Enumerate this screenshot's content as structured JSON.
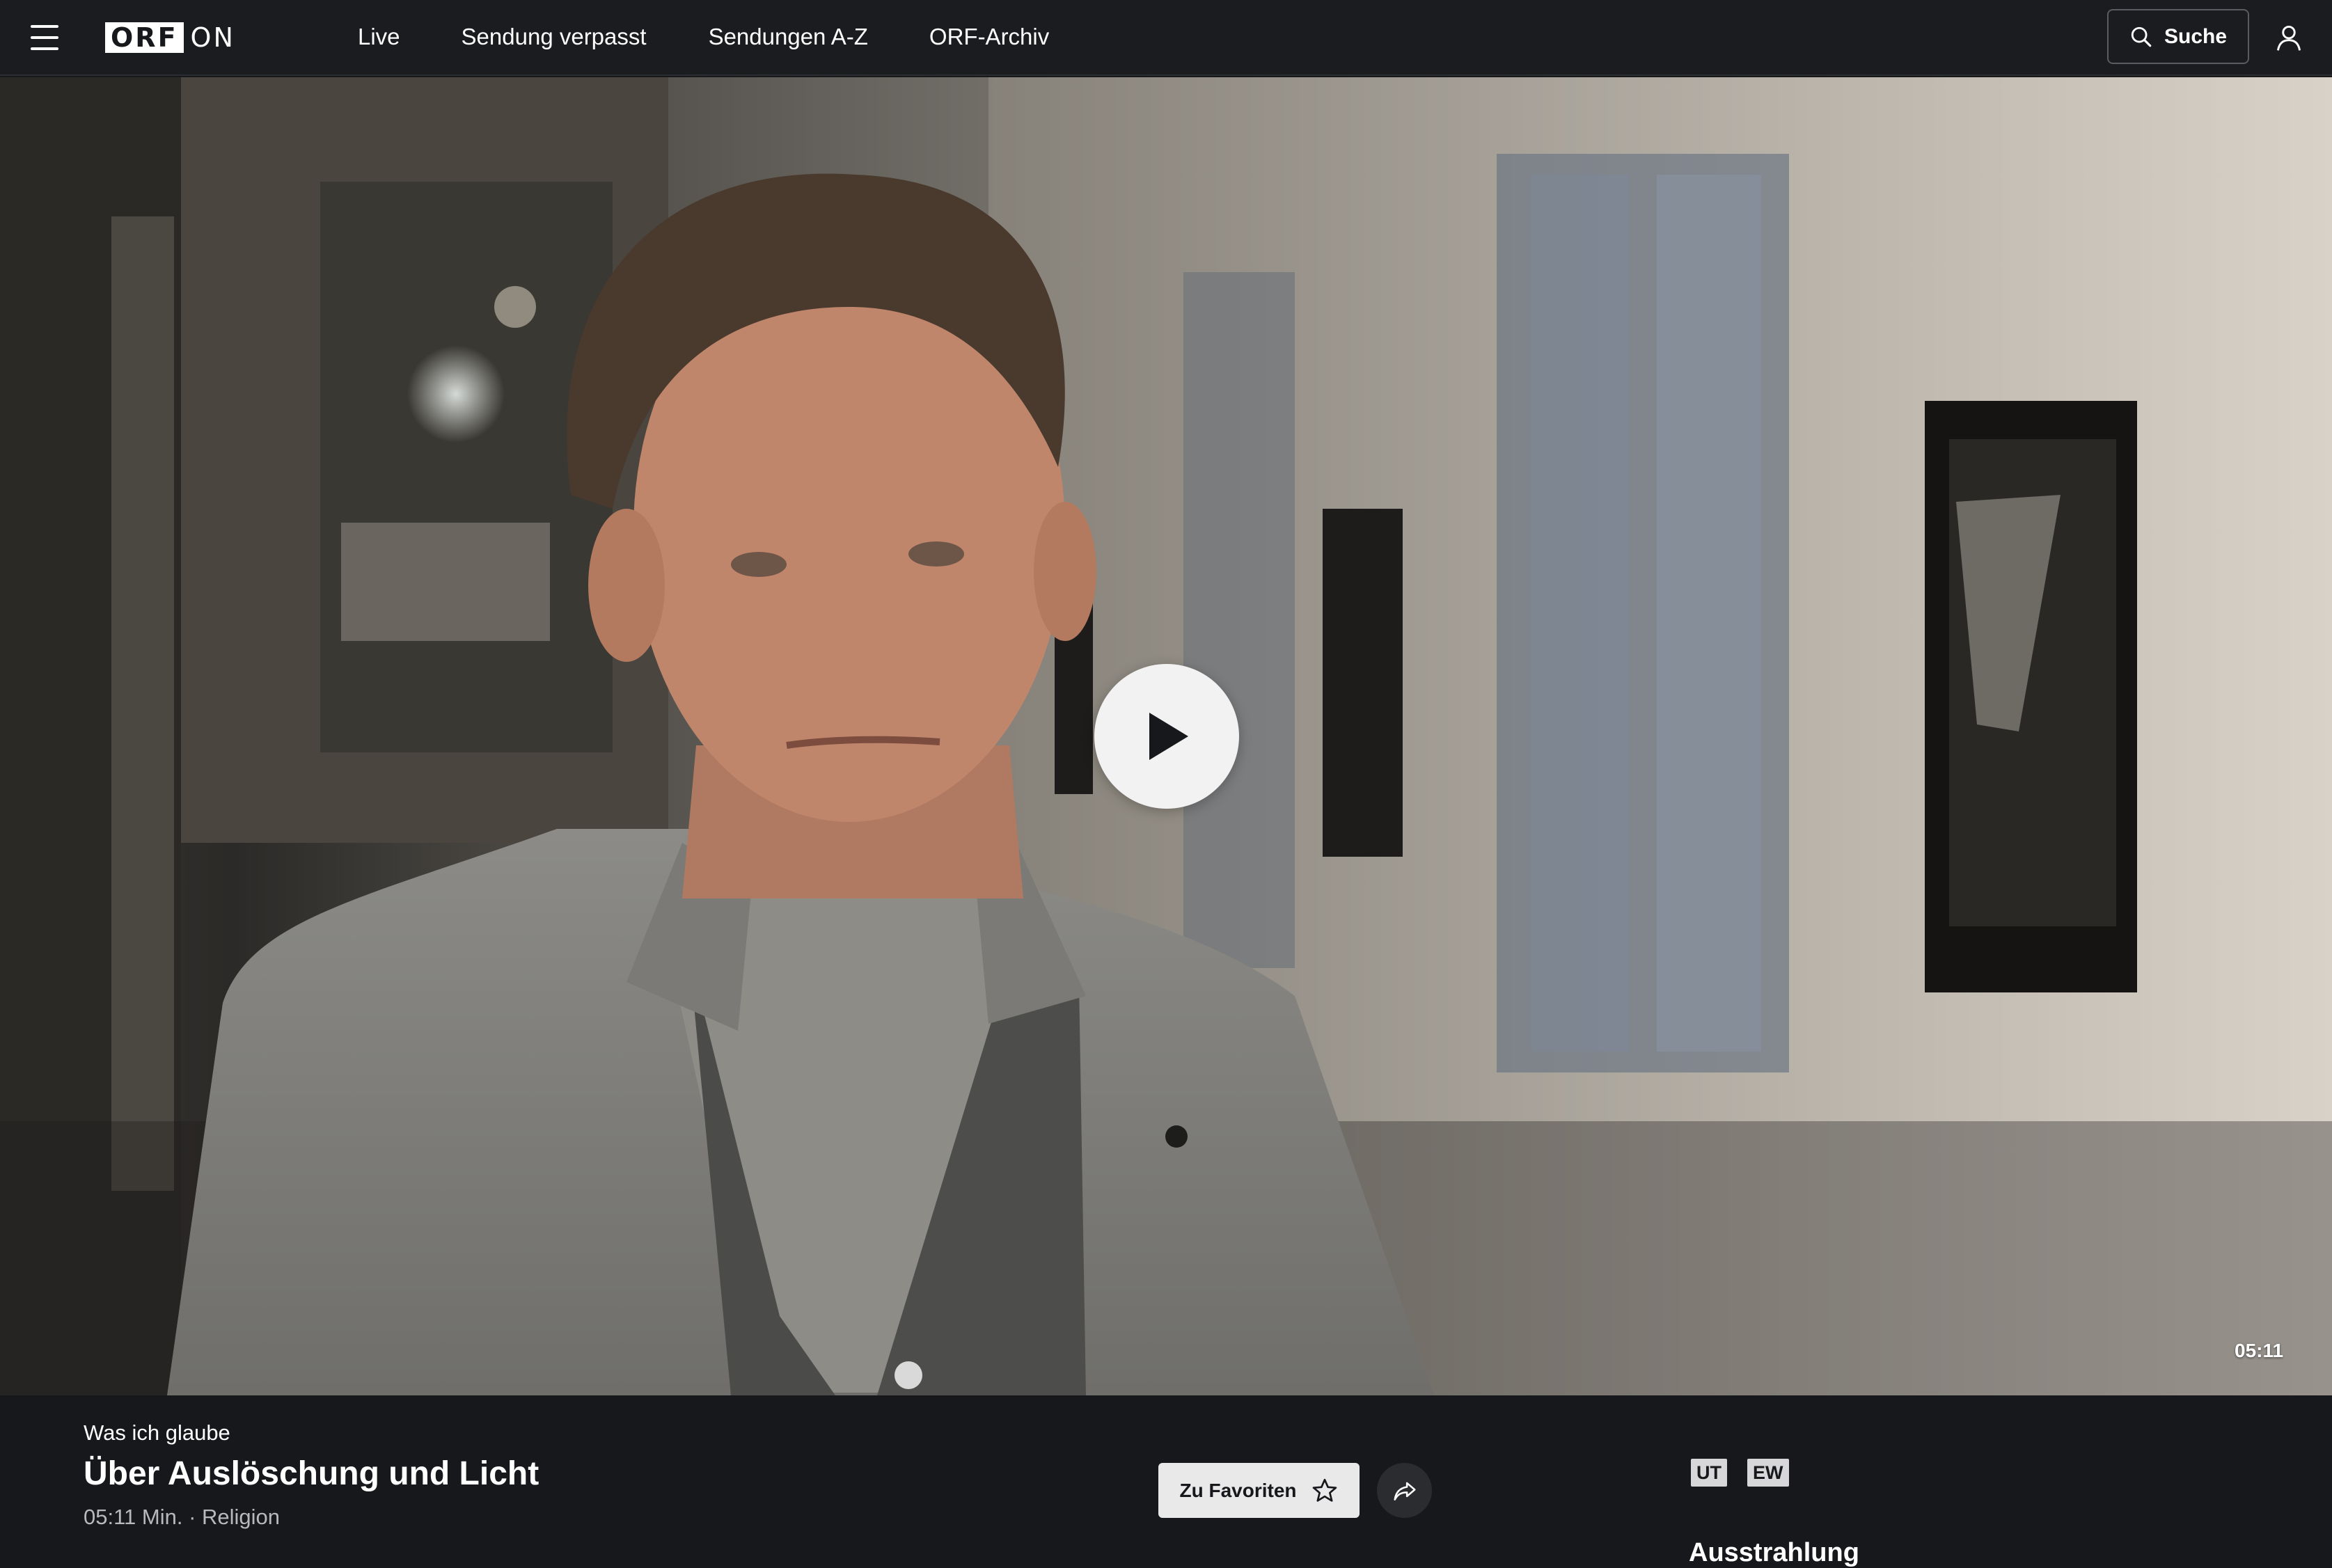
{
  "header": {
    "logo": {
      "orf": "ORF",
      "on": "ON"
    },
    "nav": [
      {
        "label": "Live"
      },
      {
        "label": "Sendung verpasst"
      },
      {
        "label": "Sendungen A-Z"
      },
      {
        "label": "ORF-Archiv"
      }
    ],
    "search_label": "Suche"
  },
  "player": {
    "duration": "05:11"
  },
  "episode": {
    "series": "Was ich glaube",
    "title": "Über Auslöschung und Licht",
    "meta": "05:11 Min. · Religion",
    "favorite_label": "Zu Favoriten",
    "badges": [
      "UT",
      "EW"
    ],
    "next_section": "Ausstrahlung"
  }
}
